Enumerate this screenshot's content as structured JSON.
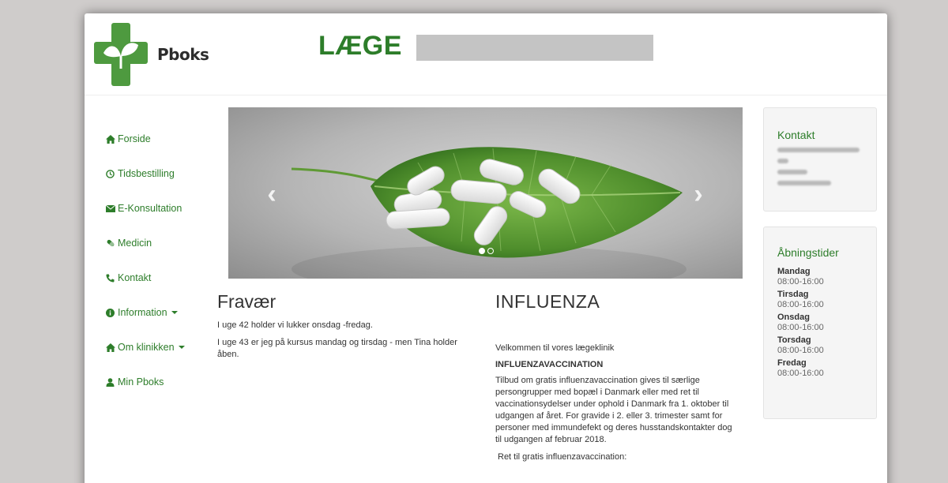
{
  "header": {
    "logo_text": "Pboks",
    "title": "LÆGE"
  },
  "nav": {
    "items": [
      {
        "label": "Forside",
        "icon": "home-icon"
      },
      {
        "label": "Tidsbestilling",
        "icon": "clock-icon"
      },
      {
        "label": "E-Konsultation",
        "icon": "envelope-icon"
      },
      {
        "label": "Medicin",
        "icon": "pill-icon"
      },
      {
        "label": "Kontakt",
        "icon": "phone-icon"
      },
      {
        "label": "Information",
        "icon": "info-icon",
        "dropdown": true
      },
      {
        "label": "Om klinikken",
        "icon": "home-icon",
        "dropdown": true
      },
      {
        "label": "Min Pboks",
        "icon": "user-icon"
      }
    ]
  },
  "carousel": {
    "prev_label": "‹",
    "next_label": "›",
    "slide_count": 2,
    "active_slide": 1
  },
  "fravaer": {
    "heading": "Fravær",
    "paragraphs": [
      "I uge 42 holder vi lukker onsdag -fredag.",
      "I uge 43 er jeg på kursus mandag og tirsdag - men Tina holder åben."
    ]
  },
  "influenza": {
    "heading": "INFLUENZA",
    "intro": "Velkommen til vores lægeklinik",
    "subheading": "INFLUENZAVACCINATION",
    "body": "Tilbud om gratis influenzavaccination gives til særlige persongrupper med bopæl i Danmark eller med ret til vaccinationsydelser under ophold i Danmark fra 1. oktober til udgangen af året. For gravide i 2. eller 3. trimester samt for personer med immundefekt og deres husstandskontakter dog til udgangen af februar 2018.",
    "footer": "Ret til gratis influenzavaccination:"
  },
  "kontakt": {
    "heading": "Kontakt"
  },
  "opening_hours": {
    "heading": "Åbningstider",
    "days": [
      {
        "day": "Mandag",
        "hours": "08:00-16:00"
      },
      {
        "day": "Tirsdag",
        "hours": "08:00-16:00"
      },
      {
        "day": "Onsdag",
        "hours": "08:00-16:00"
      },
      {
        "day": "Torsdag",
        "hours": "08:00-16:00"
      },
      {
        "day": "Fredag",
        "hours": "08:00-16:00"
      }
    ]
  },
  "colors": {
    "brand_green": "#2d7d2a",
    "logo_green": "#4e9a3f",
    "page_background": "#cfcccb"
  }
}
